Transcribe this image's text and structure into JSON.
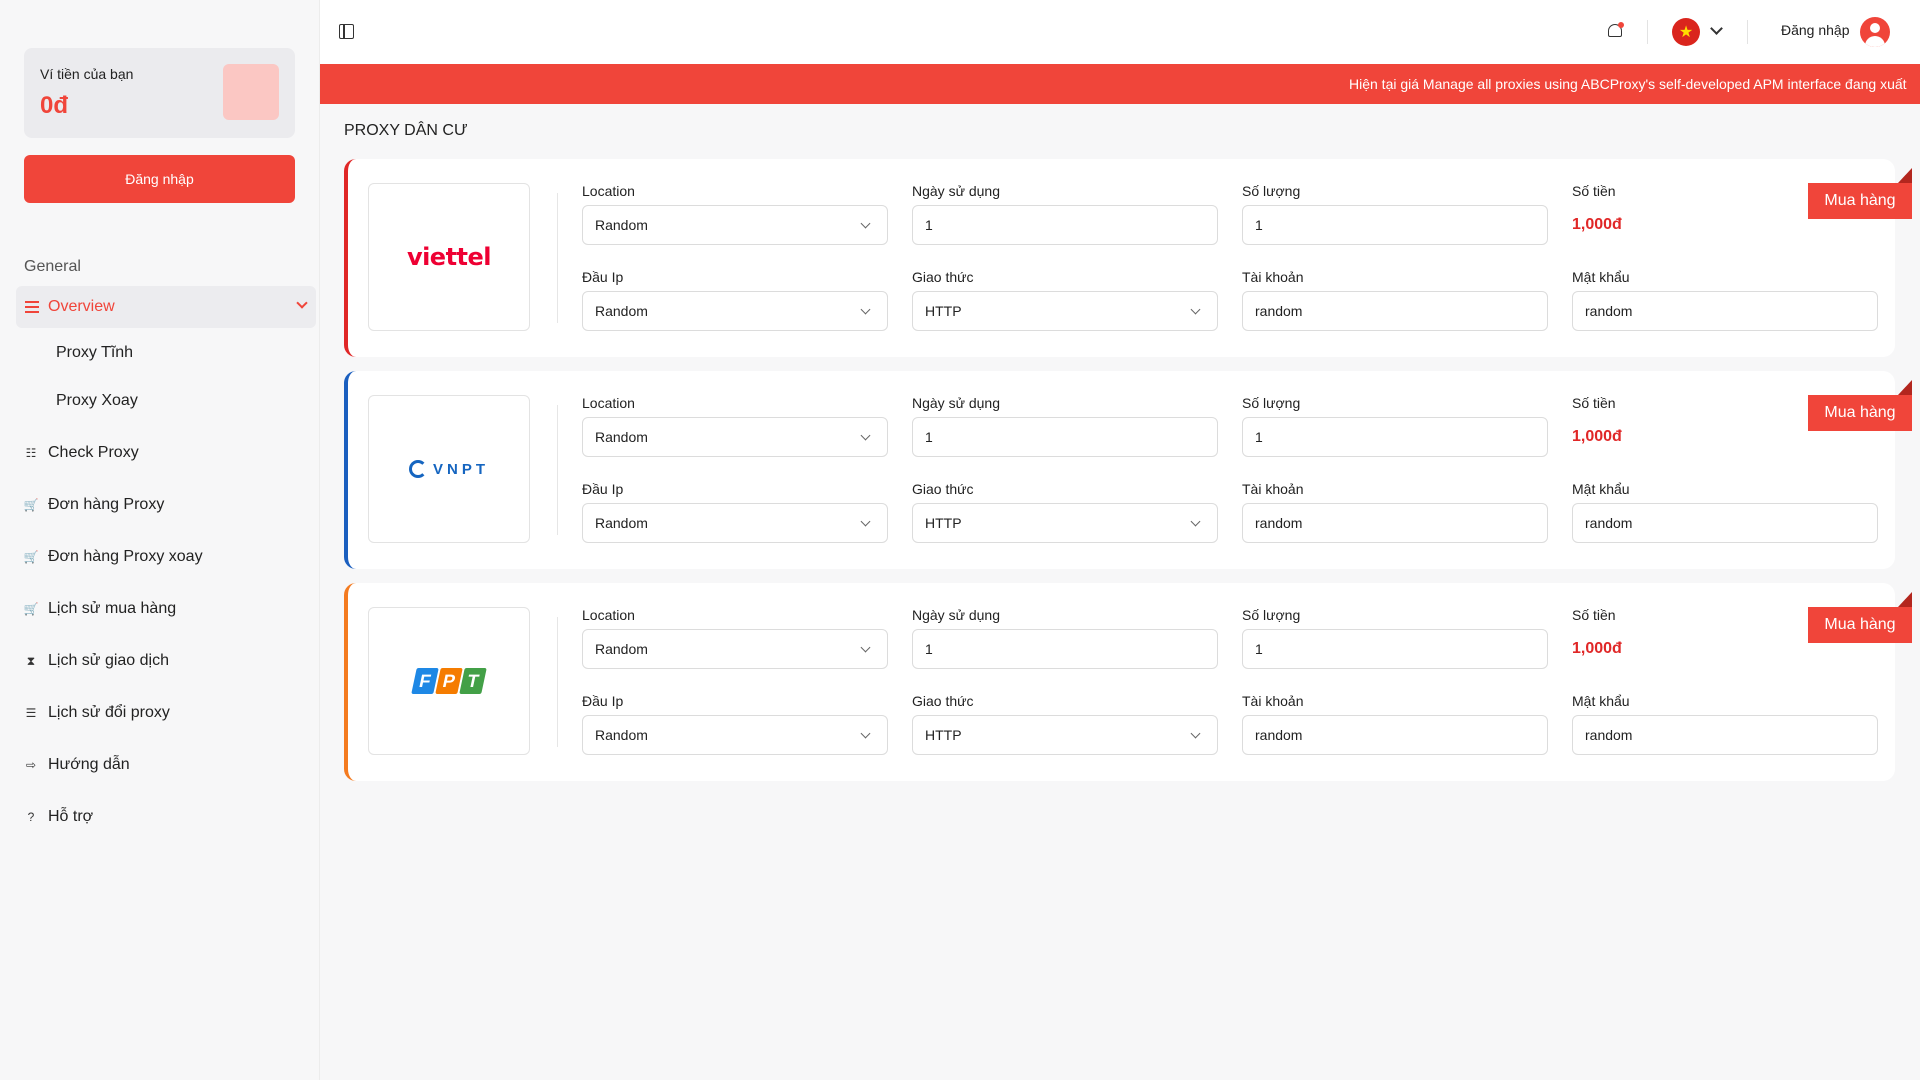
{
  "sidebar": {
    "wallet_label": "Ví tiền của bạn",
    "wallet_amount": "0đ",
    "login_label": "Đăng nhập",
    "group_label": "General",
    "overview_label": "Overview",
    "sub_items": [
      "Proxy Tĩnh",
      "Proxy Xoay"
    ],
    "items": [
      {
        "label": "Check Proxy",
        "icon": "list-check-icon"
      },
      {
        "label": "Đơn hàng Proxy",
        "icon": "cart-icon"
      },
      {
        "label": "Đơn hàng Proxy xoay",
        "icon": "cart-icon"
      },
      {
        "label": "Lịch sử mua hàng",
        "icon": "cart-plus-icon"
      },
      {
        "label": "Lịch sử giao dịch",
        "icon": "hourglass-icon"
      },
      {
        "label": "Lịch sử đổi proxy",
        "icon": "history-icon"
      },
      {
        "label": "Hướng dẫn",
        "icon": "signpost-icon"
      },
      {
        "label": "Hỗ trợ",
        "icon": "help-circle-icon"
      }
    ]
  },
  "topbar": {
    "login_label": "Đăng nhập",
    "banner_text": "Hiện tại giá Manage all proxies using ABCProxy's self-developed APM interface đang xuất"
  },
  "main": {
    "section_title": "PROXY DÂN CƯ",
    "labels": {
      "location": "Location",
      "days": "Ngày sử dụng",
      "quantity": "Số lượng",
      "amount": "Số tiền",
      "ip_prefix": "Đầu Ip",
      "protocol": "Giao thức",
      "account": "Tài khoản",
      "password": "Mật khẩu",
      "buy": "Mua hàng"
    },
    "cards": [
      {
        "provider": "viettel",
        "location": "Random",
        "days": "1",
        "quantity": "1",
        "price": "1,000đ",
        "ip_prefix": "Random",
        "protocol": "HTTP",
        "account": "random",
        "password": "random"
      },
      {
        "provider": "VNPT",
        "location": "Random",
        "days": "1",
        "quantity": "1",
        "price": "1,000đ",
        "ip_prefix": "Random",
        "protocol": "HTTP",
        "account": "random",
        "password": "random"
      },
      {
        "provider": "FPT",
        "location": "Random",
        "days": "1",
        "quantity": "1",
        "price": "1,000đ",
        "ip_prefix": "Random",
        "protocol": "HTTP",
        "account": "random",
        "password": "random"
      }
    ]
  },
  "colors": {
    "accent": "#f0453a",
    "viettel": "#e02727",
    "vnpt": "#1b5fbf",
    "fpt": "#f47b20"
  }
}
